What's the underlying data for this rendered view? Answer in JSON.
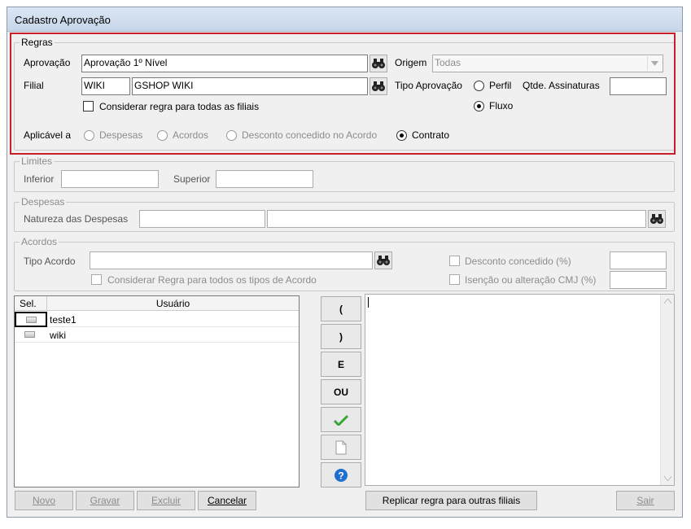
{
  "window": {
    "title": "Cadastro Aprovação"
  },
  "regras": {
    "legend": "Regras",
    "aprovacao_label": "Aprovação",
    "aprovacao_value": "Aprovação 1º Nível",
    "filial_label": "Filial",
    "filial_code": "WIKI",
    "filial_name": "GSHOP WIKI",
    "considerar_filiais": "Considerar regra para todas as filiais",
    "origem_label": "Origem",
    "origem_value": "Todas",
    "tipo_aprovacao_label": "Tipo Aprovação",
    "tipo_perfil": "Perfil",
    "tipo_fluxo": "Fluxo",
    "qtde_label": "Qtde. Assinaturas",
    "qtde_value": "",
    "aplicavel_label": "Aplicável a",
    "opt_despesas": "Despesas",
    "opt_acordos": "Acordos",
    "opt_desconto": "Desconto concedido no Acordo",
    "opt_contrato": "Contrato"
  },
  "limites": {
    "legend": "Limites",
    "inferior": "Inferior",
    "superior": "Superior"
  },
  "despesas": {
    "legend": "Despesas",
    "natureza": "Natureza das Despesas"
  },
  "acordos": {
    "legend": "Acordos",
    "tipo_acordo": "Tipo Acordo",
    "considerar_tipos": "Considerar Regra para todos os tipos de Acordo",
    "desconto": "Desconto concedido (%)",
    "isencao": "Isenção ou alteração CMJ (%)"
  },
  "grid": {
    "col_sel": "Sel.",
    "col_usuario": "Usuário",
    "rows": [
      {
        "usuario": "teste1"
      },
      {
        "usuario": "wiki"
      }
    ]
  },
  "operators": {
    "open": "(",
    "close": ")",
    "and": "E",
    "or": "OU"
  },
  "footer": {
    "novo": "Novo",
    "gravar": "Gravar",
    "excluir": "Excluir",
    "cancelar": "Cancelar",
    "replicar": "Replicar regra para outras filiais",
    "sair": "Sair"
  },
  "colors": {
    "highlight_border": "#c8202a",
    "help_icon": "#1e6fd0",
    "check_icon": "#3aa53a"
  }
}
